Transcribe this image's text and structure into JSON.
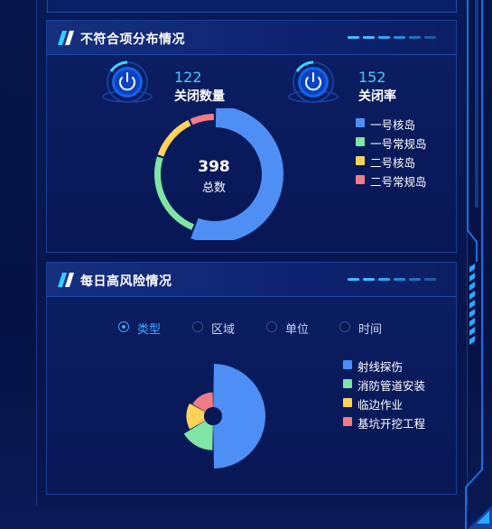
{
  "closure_panel": {
    "title": "不符合项分布情况",
    "stats": [
      {
        "value": "122",
        "label": "关闭数量",
        "icon": "power-icon"
      },
      {
        "value": "152",
        "label": "关闭率",
        "icon": "power-icon"
      }
    ],
    "total_value": "398",
    "total_label": "总数"
  },
  "risk_panel": {
    "title": "每日高风险情况",
    "filters": [
      {
        "label": "类型",
        "selected": true
      },
      {
        "label": "区域",
        "selected": false
      },
      {
        "label": "单位",
        "selected": false
      },
      {
        "label": "时间",
        "selected": false
      }
    ]
  },
  "colors": {
    "accent_blue": "#4d8ff5",
    "accent_green": "#7ee5a4",
    "accent_yellow": "#ffd25a",
    "accent_red": "#f27c86",
    "highlight": "#46c8ff"
  },
  "chart_data": [
    {
      "type": "pie",
      "variant": "donut",
      "legend_position": "right",
      "categories": [
        "一号核岛",
        "一号常规岛",
        "二号核岛",
        "二号常规岛"
      ],
      "values": [
        56,
        24,
        13,
        7
      ],
      "colors": [
        "#4d8ff5",
        "#7ee5a4",
        "#ffd25a",
        "#f27c86"
      ]
    },
    {
      "type": "pie",
      "variant": "rose",
      "legend_position": "right",
      "categories": [
        "射线探伤",
        "消防管道安装",
        "临边作业",
        "基坑开挖工程"
      ],
      "values": [
        60,
        20,
        10,
        7
      ],
      "colors": [
        "#4d8ff5",
        "#7ee5a4",
        "#ffd25a",
        "#f27c86"
      ]
    }
  ]
}
